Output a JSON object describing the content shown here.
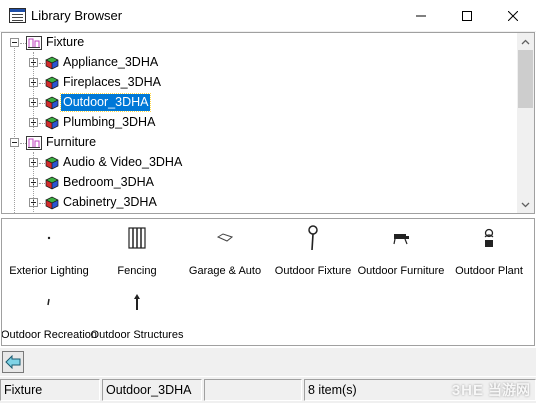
{
  "window": {
    "title": "Library Browser",
    "minimize_icon": "minimize-icon",
    "maximize_icon": "maximize-icon",
    "close_icon": "close-icon"
  },
  "tree": {
    "nodes": [
      {
        "label": "Fixture",
        "level": 0,
        "expander": "minus",
        "icon": "category-folder-icon",
        "selected": false
      },
      {
        "label": "Appliance_3DHA",
        "level": 1,
        "expander": "plus",
        "icon": "library-cube-icon",
        "selected": false
      },
      {
        "label": "Fireplaces_3DHA",
        "level": 1,
        "expander": "plus",
        "icon": "library-cube-icon",
        "selected": false
      },
      {
        "label": "Outdoor_3DHA",
        "level": 1,
        "expander": "plus",
        "icon": "library-cube-icon",
        "selected": true
      },
      {
        "label": "Plumbing_3DHA",
        "level": 1,
        "expander": "plus",
        "icon": "library-cube-icon",
        "selected": false
      },
      {
        "label": "Furniture",
        "level": 0,
        "expander": "minus",
        "icon": "category-folder-icon",
        "selected": false
      },
      {
        "label": "Audio & Video_3DHA",
        "level": 1,
        "expander": "plus",
        "icon": "library-cube-icon",
        "selected": false
      },
      {
        "label": "Bedroom_3DHA",
        "level": 1,
        "expander": "plus",
        "icon": "library-cube-icon",
        "selected": false
      },
      {
        "label": "Cabinetry_3DHA",
        "level": 1,
        "expander": "plus",
        "icon": "library-cube-icon",
        "selected": false
      }
    ]
  },
  "items": [
    {
      "label": "Exterior Lighting",
      "icon": "exterior-lighting-icon"
    },
    {
      "label": "Fencing",
      "icon": "fencing-icon"
    },
    {
      "label": "Garage & Auto",
      "icon": "garage-auto-icon"
    },
    {
      "label": "Outdoor Fixture",
      "icon": "outdoor-fixture-icon"
    },
    {
      "label": "Outdoor Furniture",
      "icon": "outdoor-furniture-icon"
    },
    {
      "label": "Outdoor Plant",
      "icon": "outdoor-plant-icon"
    },
    {
      "label": "Outdoor Recreation",
      "icon": "outdoor-recreation-icon"
    },
    {
      "label": "Outdoor Structures",
      "icon": "outdoor-structures-icon"
    }
  ],
  "toolbar": {
    "back_icon": "back-arrow-icon"
  },
  "status": {
    "category": "Fixture",
    "library": "Outdoor_3DHA",
    "count": "8 item(s)"
  },
  "watermark": {
    "logo": "3HE",
    "text": "当游网"
  },
  "colors": {
    "selection": "#0078d7",
    "chrome": "#f0f0f0",
    "border": "#a0a0a0"
  }
}
